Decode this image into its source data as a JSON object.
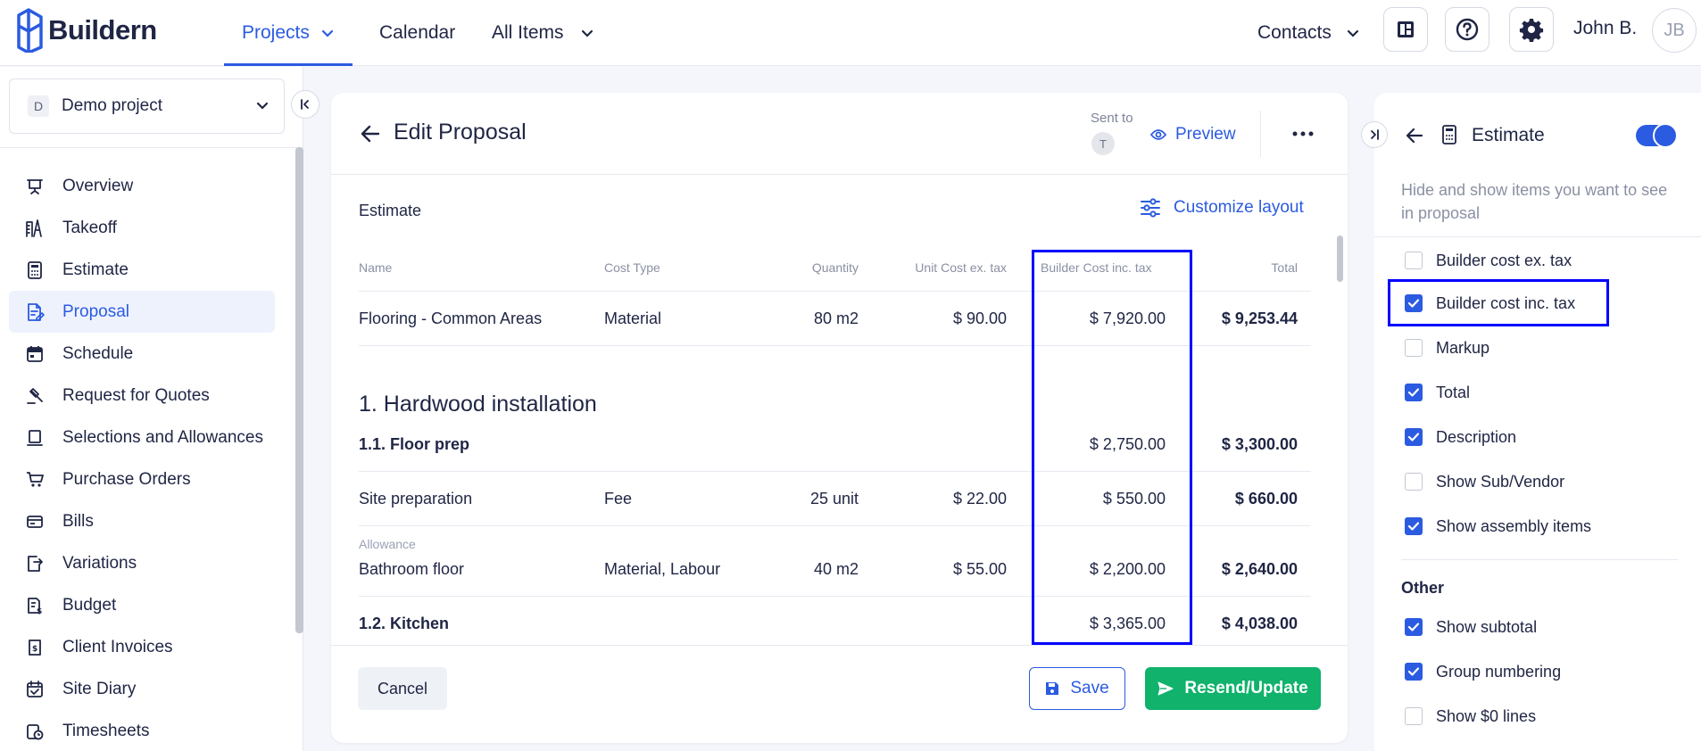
{
  "app": {
    "logo_text": "Buildern",
    "nav": [
      {
        "label": "Projects",
        "active": true,
        "has_chevron": true
      },
      {
        "label": "Calendar",
        "active": false,
        "has_chevron": false
      },
      {
        "label": "All Items",
        "active": false,
        "has_chevron": true
      }
    ],
    "contacts_label": "Contacts",
    "user_name": "John B.",
    "user_initials": "JB",
    "accent_color": "#2b5be0",
    "success_color": "#10b26c",
    "highlight_color": "#0000ff"
  },
  "sidebar": {
    "project_badge": "D",
    "project_name": "Demo project",
    "items": [
      {
        "label": "Overview",
        "icon": "presentation-icon",
        "active": false
      },
      {
        "label": "Takeoff",
        "icon": "takeoff-icon",
        "active": false
      },
      {
        "label": "Estimate",
        "icon": "calculator-icon",
        "active": false
      },
      {
        "label": "Proposal",
        "icon": "proposal-icon",
        "active": true
      },
      {
        "label": "Schedule",
        "icon": "calendar-icon",
        "active": false
      },
      {
        "label": "Request for Quotes",
        "icon": "gavel-icon",
        "active": false
      },
      {
        "label": "Selections and Allowances",
        "icon": "selections-icon",
        "active": false
      },
      {
        "label": "Purchase Orders",
        "icon": "cart-icon",
        "active": false
      },
      {
        "label": "Bills",
        "icon": "bills-icon",
        "active": false
      },
      {
        "label": "Variations",
        "icon": "variations-icon",
        "active": false
      },
      {
        "label": "Budget",
        "icon": "budget-icon",
        "active": false
      },
      {
        "label": "Client Invoices",
        "icon": "invoice-icon",
        "active": false
      },
      {
        "label": "Site Diary",
        "icon": "diary-icon",
        "active": false
      },
      {
        "label": "Timesheets",
        "icon": "timesheet-icon",
        "active": false
      }
    ]
  },
  "proposal": {
    "title": "Edit Proposal",
    "sent_to_label": "Sent to",
    "sent_to_initial": "T",
    "preview_label": "Preview",
    "section_title": "Estimate",
    "customize_label": "Customize layout",
    "columns": [
      "Name",
      "Cost Type",
      "Quantity",
      "Unit Cost ex. tax",
      "Builder Cost inc. tax",
      "Total"
    ],
    "first_row": {
      "name": "Flooring - Common Areas",
      "cost_type": "Material",
      "quantity": "80 m2",
      "unit_cost": "$ 90.00",
      "builder_cost": "$ 7,920.00",
      "total": "$ 9,253.44"
    },
    "group_title": "1. Hardwood installation",
    "subgroup_1": {
      "name": "1.1. Floor prep",
      "builder_cost": "$ 2,750.00",
      "total": "$ 3,300.00"
    },
    "row_site": {
      "name": "Site preparation",
      "cost_type": "Fee",
      "quantity": "25 unit",
      "unit_cost": "$ 22.00",
      "builder_cost": "$ 550.00",
      "total": "$ 660.00"
    },
    "row_bath": {
      "tag": "Allowance",
      "name": "Bathroom floor",
      "cost_type": "Material, Labour",
      "quantity": "40 m2",
      "unit_cost": "$ 55.00",
      "builder_cost": "$ 2,200.00",
      "total": "$ 2,640.00"
    },
    "subgroup_2": {
      "name": "1.2. Kitchen",
      "builder_cost": "$ 3,365.00",
      "total": "$ 4,038.00"
    },
    "cancel_label": "Cancel",
    "save_label": "Save",
    "resend_label": "Resend/Update"
  },
  "estimate_panel": {
    "title": "Estimate",
    "toggle_on": true,
    "description": "Hide and show items you want to see in proposal",
    "options": [
      {
        "label": "Builder cost ex. tax",
        "checked": false
      },
      {
        "label": "Builder cost inc. tax",
        "checked": true
      },
      {
        "label": "Markup",
        "checked": false
      },
      {
        "label": "Total",
        "checked": true
      },
      {
        "label": "Description",
        "checked": true
      },
      {
        "label": "Show Sub/Vendor",
        "checked": false
      },
      {
        "label": "Show assembly items",
        "checked": true
      }
    ],
    "other_label": "Other",
    "other_options": [
      {
        "label": "Show subtotal",
        "checked": true
      },
      {
        "label": "Group numbering",
        "checked": true
      },
      {
        "label": "Show $0 lines",
        "checked": false
      }
    ]
  }
}
